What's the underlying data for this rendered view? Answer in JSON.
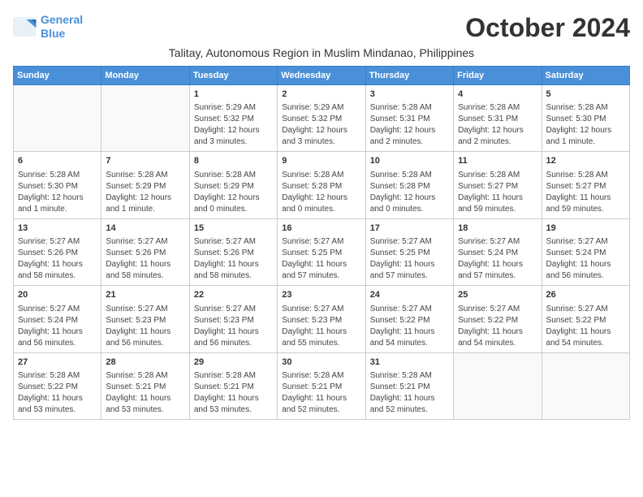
{
  "header": {
    "logo_line1": "General",
    "logo_line2": "Blue",
    "month_title": "October 2024",
    "subtitle": "Talitay, Autonomous Region in Muslim Mindanao, Philippines"
  },
  "weekdays": [
    "Sunday",
    "Monday",
    "Tuesday",
    "Wednesday",
    "Thursday",
    "Friday",
    "Saturday"
  ],
  "weeks": [
    [
      {
        "day": "",
        "info": ""
      },
      {
        "day": "",
        "info": ""
      },
      {
        "day": "1",
        "info": "Sunrise: 5:29 AM\nSunset: 5:32 PM\nDaylight: 12 hours\nand 3 minutes."
      },
      {
        "day": "2",
        "info": "Sunrise: 5:29 AM\nSunset: 5:32 PM\nDaylight: 12 hours\nand 3 minutes."
      },
      {
        "day": "3",
        "info": "Sunrise: 5:28 AM\nSunset: 5:31 PM\nDaylight: 12 hours\nand 2 minutes."
      },
      {
        "day": "4",
        "info": "Sunrise: 5:28 AM\nSunset: 5:31 PM\nDaylight: 12 hours\nand 2 minutes."
      },
      {
        "day": "5",
        "info": "Sunrise: 5:28 AM\nSunset: 5:30 PM\nDaylight: 12 hours\nand 1 minute."
      }
    ],
    [
      {
        "day": "6",
        "info": "Sunrise: 5:28 AM\nSunset: 5:30 PM\nDaylight: 12 hours\nand 1 minute."
      },
      {
        "day": "7",
        "info": "Sunrise: 5:28 AM\nSunset: 5:29 PM\nDaylight: 12 hours\nand 1 minute."
      },
      {
        "day": "8",
        "info": "Sunrise: 5:28 AM\nSunset: 5:29 PM\nDaylight: 12 hours\nand 0 minutes."
      },
      {
        "day": "9",
        "info": "Sunrise: 5:28 AM\nSunset: 5:28 PM\nDaylight: 12 hours\nand 0 minutes."
      },
      {
        "day": "10",
        "info": "Sunrise: 5:28 AM\nSunset: 5:28 PM\nDaylight: 12 hours\nand 0 minutes."
      },
      {
        "day": "11",
        "info": "Sunrise: 5:28 AM\nSunset: 5:27 PM\nDaylight: 11 hours\nand 59 minutes."
      },
      {
        "day": "12",
        "info": "Sunrise: 5:28 AM\nSunset: 5:27 PM\nDaylight: 11 hours\nand 59 minutes."
      }
    ],
    [
      {
        "day": "13",
        "info": "Sunrise: 5:27 AM\nSunset: 5:26 PM\nDaylight: 11 hours\nand 58 minutes."
      },
      {
        "day": "14",
        "info": "Sunrise: 5:27 AM\nSunset: 5:26 PM\nDaylight: 11 hours\nand 58 minutes."
      },
      {
        "day": "15",
        "info": "Sunrise: 5:27 AM\nSunset: 5:26 PM\nDaylight: 11 hours\nand 58 minutes."
      },
      {
        "day": "16",
        "info": "Sunrise: 5:27 AM\nSunset: 5:25 PM\nDaylight: 11 hours\nand 57 minutes."
      },
      {
        "day": "17",
        "info": "Sunrise: 5:27 AM\nSunset: 5:25 PM\nDaylight: 11 hours\nand 57 minutes."
      },
      {
        "day": "18",
        "info": "Sunrise: 5:27 AM\nSunset: 5:24 PM\nDaylight: 11 hours\nand 57 minutes."
      },
      {
        "day": "19",
        "info": "Sunrise: 5:27 AM\nSunset: 5:24 PM\nDaylight: 11 hours\nand 56 minutes."
      }
    ],
    [
      {
        "day": "20",
        "info": "Sunrise: 5:27 AM\nSunset: 5:24 PM\nDaylight: 11 hours\nand 56 minutes."
      },
      {
        "day": "21",
        "info": "Sunrise: 5:27 AM\nSunset: 5:23 PM\nDaylight: 11 hours\nand 56 minutes."
      },
      {
        "day": "22",
        "info": "Sunrise: 5:27 AM\nSunset: 5:23 PM\nDaylight: 11 hours\nand 56 minutes."
      },
      {
        "day": "23",
        "info": "Sunrise: 5:27 AM\nSunset: 5:23 PM\nDaylight: 11 hours\nand 55 minutes."
      },
      {
        "day": "24",
        "info": "Sunrise: 5:27 AM\nSunset: 5:22 PM\nDaylight: 11 hours\nand 54 minutes."
      },
      {
        "day": "25",
        "info": "Sunrise: 5:27 AM\nSunset: 5:22 PM\nDaylight: 11 hours\nand 54 minutes."
      },
      {
        "day": "26",
        "info": "Sunrise: 5:27 AM\nSunset: 5:22 PM\nDaylight: 11 hours\nand 54 minutes."
      }
    ],
    [
      {
        "day": "27",
        "info": "Sunrise: 5:28 AM\nSunset: 5:22 PM\nDaylight: 11 hours\nand 53 minutes."
      },
      {
        "day": "28",
        "info": "Sunrise: 5:28 AM\nSunset: 5:21 PM\nDaylight: 11 hours\nand 53 minutes."
      },
      {
        "day": "29",
        "info": "Sunrise: 5:28 AM\nSunset: 5:21 PM\nDaylight: 11 hours\nand 53 minutes."
      },
      {
        "day": "30",
        "info": "Sunrise: 5:28 AM\nSunset: 5:21 PM\nDaylight: 11 hours\nand 52 minutes."
      },
      {
        "day": "31",
        "info": "Sunrise: 5:28 AM\nSunset: 5:21 PM\nDaylight: 11 hours\nand 52 minutes."
      },
      {
        "day": "",
        "info": ""
      },
      {
        "day": "",
        "info": ""
      }
    ]
  ]
}
